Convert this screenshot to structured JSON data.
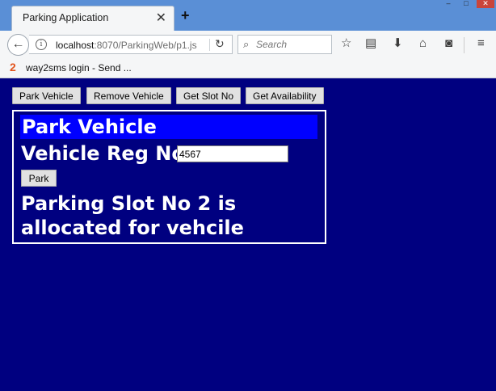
{
  "browser": {
    "tab_title": "Parking Application",
    "url_host": "localhost",
    "url_rest": ":8070/ParkingWeb/p1.js",
    "search_placeholder": "Search",
    "bookmark_favicon": "2",
    "bookmark_label": "way2sms login - Send ..."
  },
  "toolbar": {
    "buttons": [
      "Park Vehicle",
      "Remove Vehicle",
      "Get Slot No",
      "Get Availability"
    ]
  },
  "panel": {
    "title": "Park Vehicle",
    "reg_label": "Vehicle Reg No",
    "reg_value": "4567",
    "park_button": "Park",
    "result_text": "Parking Slot No 2 is allocated for vehcile"
  },
  "colors": {
    "page_background": "#000080",
    "header_background": "#0000ff",
    "browser_tab_strip": "#5a8fd6"
  }
}
